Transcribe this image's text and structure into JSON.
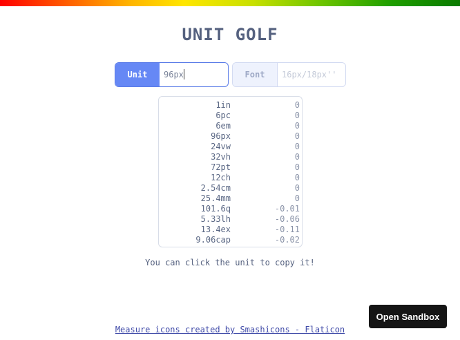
{
  "title": "UNIT GOLF",
  "unit_field": {
    "label": "Unit",
    "value": "96px"
  },
  "font_field": {
    "label": "Font",
    "placeholder": "16px/18px''"
  },
  "results": [
    {
      "unit": "1in",
      "diff": "0"
    },
    {
      "unit": "6pc",
      "diff": "0"
    },
    {
      "unit": "6em",
      "diff": "0"
    },
    {
      "unit": "96px",
      "diff": "0"
    },
    {
      "unit": "24vw",
      "diff": "0"
    },
    {
      "unit": "32vh",
      "diff": "0"
    },
    {
      "unit": "72pt",
      "diff": "0"
    },
    {
      "unit": "12ch",
      "diff": "0"
    },
    {
      "unit": "2.54cm",
      "diff": "0"
    },
    {
      "unit": "25.4mm",
      "diff": "0"
    },
    {
      "unit": "101.6q",
      "diff": "-0.01"
    },
    {
      "unit": "5.33lh",
      "diff": "-0.06"
    },
    {
      "unit": "13.4ex",
      "diff": "-0.11"
    },
    {
      "unit": "9.06cap",
      "diff": "-0.02"
    }
  ],
  "hint": "You can click the unit to copy it!",
  "attribution": "Measure icons created by Smashicons - Flaticon",
  "sandbox_button": "Open Sandbox",
  "colors": {
    "accent": "#6688f5",
    "accent_border": "#5b7ce8",
    "text": "#55617f",
    "link": "#3f4aa8",
    "sandbox_bg": "#151515"
  }
}
